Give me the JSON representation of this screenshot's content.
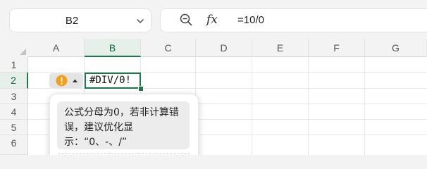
{
  "name_box": {
    "value": "B2"
  },
  "formula_bar": {
    "zoom_icon": "zoom-search-icon",
    "fx_label": "fx",
    "formula": "=10/0"
  },
  "columns": [
    "A",
    "B",
    "C",
    "D",
    "E",
    "F",
    "G"
  ],
  "rows": [
    "1",
    "2",
    "3",
    "4",
    "5",
    "6"
  ],
  "active_cell": {
    "ref": "B2",
    "value": "#DIV/0!"
  },
  "error_indicator": {
    "icon": "warning-circle-icon",
    "color": "#f0a020"
  },
  "error_popup": {
    "message": "公式分母为0，若非计算错误，建议优化显示：“0、-、/”"
  },
  "colors": {
    "accent": "#1b7a4a",
    "header_active_bg": "#e6efe9"
  }
}
